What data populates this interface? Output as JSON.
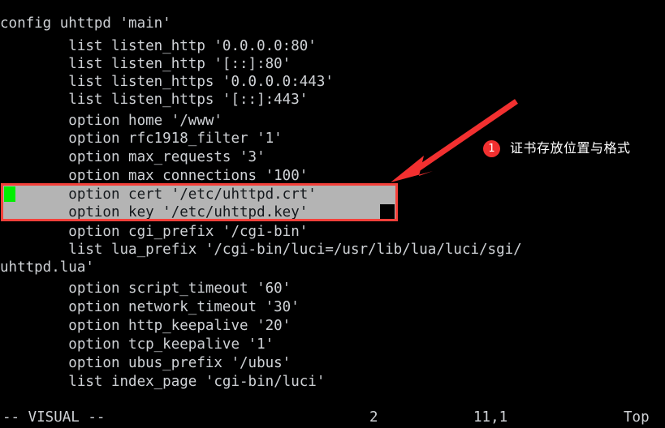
{
  "editor": {
    "filetype": "uci-config",
    "colors": {
      "background": "#000000",
      "foreground": "#cfd2d6",
      "selection_bg": "#b4b4b4",
      "selection_fg": "#14181c",
      "cursor_green": "#00ef00",
      "annotation_red": "#f23030",
      "highlight_border": "#f4403a"
    },
    "lines": [
      {
        "text": "config uhttpd 'main'",
        "indent": 0,
        "selected": false
      },
      {
        "text": "        list listen_http '0.0.0.0:80'",
        "indent": 8,
        "selected": false
      },
      {
        "text": "        list listen_http '[::]:80'",
        "indent": 8,
        "selected": false
      },
      {
        "text": "        list listen_https '0.0.0.0:443'",
        "indent": 8,
        "selected": false
      },
      {
        "text": "        list listen_https '[::]:443'",
        "indent": 8,
        "selected": false
      },
      {
        "text": "        option home '/www'",
        "indent": 8,
        "selected": false
      },
      {
        "text": "        option rfc1918_filter '1'",
        "indent": 8,
        "selected": false
      },
      {
        "text": "        option max_requests '3'",
        "indent": 8,
        "selected": false
      },
      {
        "text": "        option max connections '100'",
        "indent": 8,
        "selected": false
      },
      {
        "text": "        option cert '/etc/uhttpd.crt'",
        "indent": 8,
        "selected": true
      },
      {
        "text": "        option key '/etc/uhttpd.key'",
        "indent": 8,
        "selected": true
      },
      {
        "text": "        option cgi_prefix '/cgi-bin'",
        "indent": 8,
        "selected": false
      },
      {
        "text": "        list lua_prefix '/cgi-bin/luci=/usr/lib/lua/luci/sgi/",
        "indent": 8,
        "selected": false
      },
      {
        "text": "uhttpd.lua'",
        "indent": 0,
        "selected": false
      },
      {
        "text": "        option script_timeout '60'",
        "indent": 8,
        "selected": false
      },
      {
        "text": "        option network_timeout '30'",
        "indent": 8,
        "selected": false
      },
      {
        "text": "        option http_keepalive '20'",
        "indent": 8,
        "selected": false
      },
      {
        "text": "        option tcp_keepalive '1'",
        "indent": 8,
        "selected": false
      },
      {
        "text": "        option ubus_prefix '/ubus'",
        "indent": 8,
        "selected": false
      },
      {
        "text": "        list index_page 'cgi-bin/luci'",
        "indent": 8,
        "selected": false
      }
    ]
  },
  "status_line": {
    "mode": "-- VISUAL --",
    "selected_count": "2",
    "cursor_position": "11,1",
    "scroll_position": "Top"
  },
  "annotation": {
    "badge": "1",
    "text": "证书存放位置与格式",
    "arrow": "arrow-down-left"
  }
}
